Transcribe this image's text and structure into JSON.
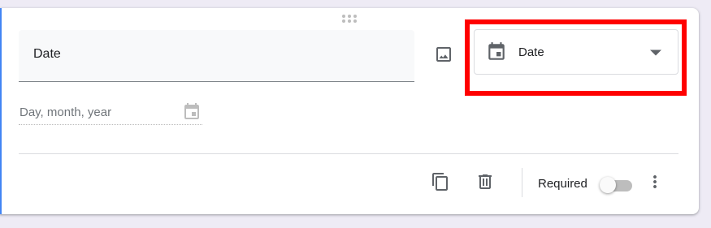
{
  "question": {
    "title": "Date",
    "answer_placeholder": "Day, month, year"
  },
  "type_selector": {
    "selected_label": "Date",
    "icon": "calendar-icon"
  },
  "footer": {
    "required_label": "Required",
    "required_on": false,
    "actions": [
      "duplicate-icon",
      "delete-icon",
      "more-vert-icon"
    ]
  },
  "colors": {
    "highlight": "#ff0000",
    "accent_border": "#4285f4",
    "icon": "#5f6368"
  }
}
